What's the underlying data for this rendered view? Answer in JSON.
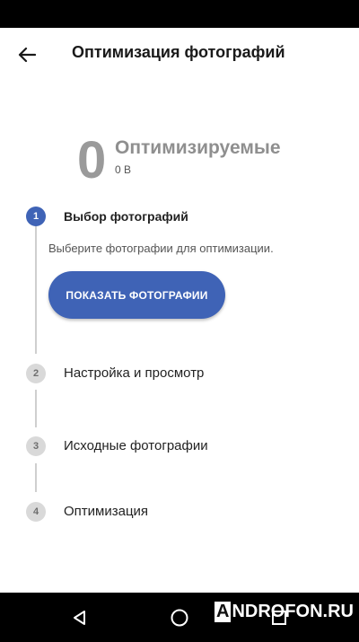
{
  "app_bar": {
    "title": "Оптимизация фотографий",
    "back_icon": "arrow-left-icon"
  },
  "summary": {
    "count": "0",
    "title": "Оптимизируемые",
    "size": "0 B"
  },
  "steps": [
    {
      "number": "1",
      "label": "Выбор фотографий",
      "state": "active"
    },
    {
      "number": "2",
      "label": "Настройка и просмотр",
      "state": "inactive"
    },
    {
      "number": "3",
      "label": "Исходные фотографии",
      "state": "inactive"
    },
    {
      "number": "4",
      "label": "Оптимизация",
      "state": "inactive"
    }
  ],
  "step1": {
    "description": "Выберите фотографии для оптимизации.",
    "button_label": "ПОКАЗАТЬ ФОТОГРАФИИ"
  },
  "nav_bar": {
    "back_icon": "triangle-back-icon",
    "home_icon": "circle-home-icon",
    "recents_icon": "square-recents-icon"
  },
  "watermark": {
    "first_letter": "A",
    "rest": "NDROFON.RU"
  },
  "colors": {
    "accent": "#3f63b6",
    "inactive_circle": "#d9d9d9",
    "muted_text": "#9a9a9a"
  }
}
